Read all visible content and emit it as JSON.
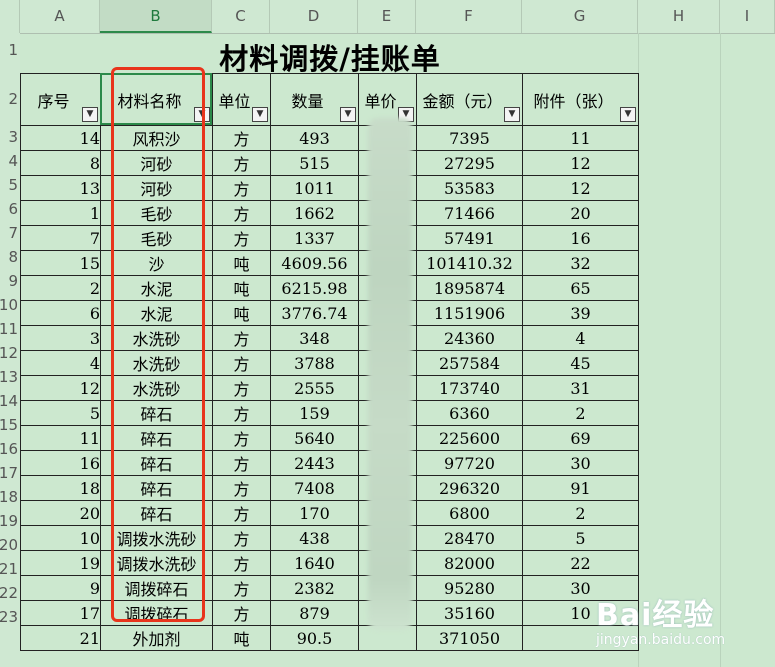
{
  "columns": [
    "A",
    "B",
    "C",
    "D",
    "E",
    "F",
    "G",
    "H",
    "I"
  ],
  "selected_column": "B",
  "rows": [
    "1",
    "2",
    "3",
    "4",
    "5",
    "6",
    "7",
    "8",
    "9",
    "10",
    "11",
    "12",
    "13",
    "14",
    "15",
    "16",
    "17",
    "18",
    "19",
    "20",
    "21",
    "22",
    "23"
  ],
  "title": "材料调拨/挂账单",
  "table": {
    "headers": [
      "序号",
      "材料名称",
      "单位",
      "数量",
      "单价",
      "金额（元）",
      "附件（张）"
    ],
    "rows": [
      [
        "14",
        "风积沙",
        "方",
        "493",
        "",
        "7395",
        "11"
      ],
      [
        "8",
        "河砂",
        "方",
        "515",
        "",
        "27295",
        "12"
      ],
      [
        "13",
        "河砂",
        "方",
        "1011",
        "",
        "53583",
        "12"
      ],
      [
        "1",
        "毛砂",
        "方",
        "1662",
        "",
        "71466",
        "20"
      ],
      [
        "7",
        "毛砂",
        "方",
        "1337",
        "",
        "57491",
        "16"
      ],
      [
        "15",
        "沙",
        "吨",
        "4609.56",
        "",
        "101410.32",
        "32"
      ],
      [
        "2",
        "水泥",
        "吨",
        "6215.98",
        "",
        "1895874",
        "65"
      ],
      [
        "6",
        "水泥",
        "吨",
        "3776.74",
        "",
        "1151906",
        "39"
      ],
      [
        "3",
        "水洗砂",
        "方",
        "348",
        "",
        "24360",
        "4"
      ],
      [
        "4",
        "水洗砂",
        "方",
        "3788",
        "",
        "257584",
        "45"
      ],
      [
        "12",
        "水洗砂",
        "方",
        "2555",
        "",
        "173740",
        "31"
      ],
      [
        "5",
        "碎石",
        "方",
        "159",
        "",
        "6360",
        "2"
      ],
      [
        "11",
        "碎石",
        "方",
        "5640",
        "",
        "225600",
        "69"
      ],
      [
        "16",
        "碎石",
        "方",
        "2443",
        "",
        "97720",
        "30"
      ],
      [
        "18",
        "碎石",
        "方",
        "7408",
        "",
        "296320",
        "91"
      ],
      [
        "20",
        "碎石",
        "方",
        "170",
        "",
        "6800",
        "2"
      ],
      [
        "10",
        "调拨水洗砂",
        "方",
        "438",
        "",
        "28470",
        "5"
      ],
      [
        "19",
        "调拨水洗砂",
        "方",
        "1640",
        "",
        "82000",
        "22"
      ],
      [
        "9",
        "调拨碎石",
        "方",
        "2382",
        "",
        "95280",
        "30"
      ],
      [
        "17",
        "调拨碎石",
        "方",
        "879",
        "",
        "35160",
        "10"
      ],
      [
        "21",
        "外加剂",
        "吨",
        "90.5",
        "",
        "371050",
        ""
      ]
    ]
  },
  "filter_icon": "filter-dropdown-icon",
  "watermark": {
    "logo": "Bai经验",
    "url": "jingyan.baidu.com"
  },
  "colors": {
    "sheet_bg": "#cce8cf",
    "highlight_box": "#e8341c",
    "selection": "#2c8a4a"
  }
}
